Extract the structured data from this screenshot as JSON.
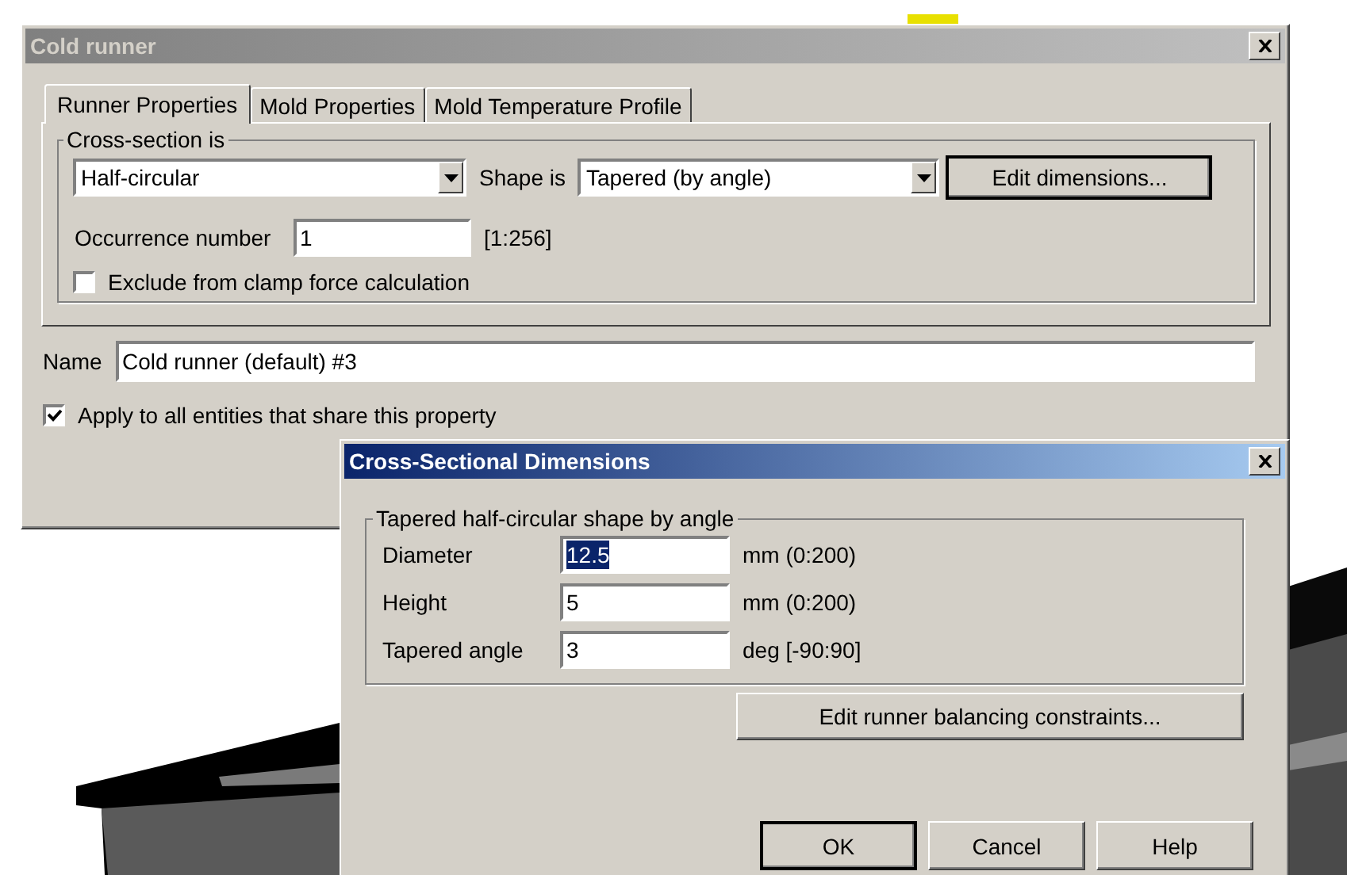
{
  "main_dialog": {
    "title": "Cold runner",
    "active": false,
    "tabs": [
      {
        "label": "Runner Properties",
        "selected": true
      },
      {
        "label": "Mold Properties",
        "selected": false
      },
      {
        "label": "Mold Temperature Profile",
        "selected": false
      }
    ],
    "cross_section_group": {
      "legend": "Cross-section is",
      "cross_section": {
        "value": "Half-circular"
      },
      "shape_label": "Shape is",
      "shape": {
        "value": "Tapered (by angle)"
      },
      "edit_button": "Edit dimensions...",
      "occurrence": {
        "label": "Occurrence number",
        "value": "1",
        "range": "[1:256]"
      },
      "exclude": {
        "label": "Exclude from clamp force calculation",
        "checked": false
      }
    },
    "name": {
      "label": "Name",
      "value": "Cold runner (default) #3"
    },
    "apply_all": {
      "label": "Apply to all entities that share this property",
      "checked": true
    }
  },
  "dimensions_dialog": {
    "title": "Cross-Sectional Dimensions",
    "active": true,
    "group": {
      "legend": "Tapered half-circular shape by angle",
      "fields": [
        {
          "label": "Diameter",
          "value": "12.5",
          "unit": "mm (0:200)",
          "text_selected": true
        },
        {
          "label": "Height",
          "value": "5",
          "unit": "mm (0:200)",
          "text_selected": false
        },
        {
          "label": "Tapered angle",
          "value": "3",
          "unit": "deg [-90:90]",
          "text_selected": false
        }
      ]
    },
    "balancing_button": "Edit runner balancing constraints...",
    "buttons": [
      "OK",
      "Cancel",
      "Help"
    ]
  }
}
